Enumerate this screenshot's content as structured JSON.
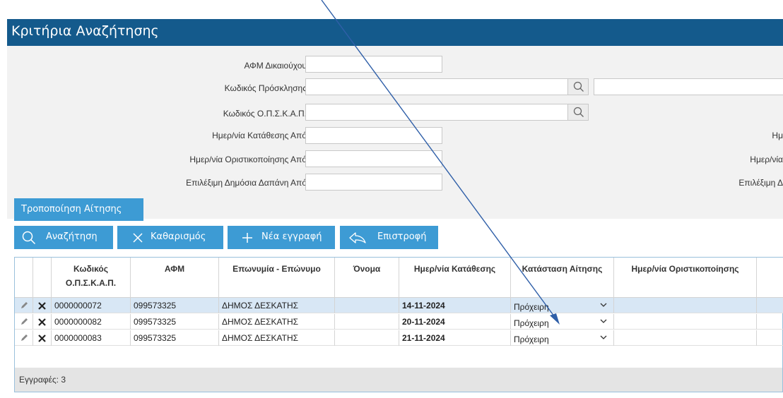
{
  "header": {
    "title": "Κριτήρια Αναζήτησης"
  },
  "fields": {
    "afm_label": "ΑΦΜ Δικαιούχου",
    "invitation_label": "Κωδικός Πρόσκλησης",
    "opskap_label": "Κωδικός Ο.Π.Σ.Κ.Α.Π.",
    "submit_from_label": "Ημερ/νία Κατάθεσης Από",
    "finalize_from_label": "Ημερ/νία Οριστικοποίησης Από",
    "expense_from_label": "Επιλέξιμη Δημόσια Δαπάνη Από",
    "submit_to_label_partial": "Ημ",
    "finalize_to_label_partial": "Ημερ/νία",
    "expense_to_label_partial": "Επιλέξιμη Δ"
  },
  "buttons": {
    "modify": "Τροποποίηση Αίτησης",
    "search": "Αναζήτηση",
    "clear": "Καθαρισμός",
    "new_record": "Νέα εγγραφή",
    "back": "Επιστροφή"
  },
  "colors": {
    "title_bar": "#145a8c",
    "button": "#3d9bd4",
    "selected_row": "#d8e7f5"
  },
  "table": {
    "columns": [
      "Κωδικός Ο.Π.Σ.Κ.Α.Π.",
      "ΑΦΜ",
      "Επωνυμία - Επώνυμο",
      "Όνομα",
      "Ημερ/νία Κατάθεσης",
      "Κατάσταση Αίτησης",
      "Ημερ/νία Οριστικοποίησης"
    ],
    "rows": [
      {
        "code": "0000000072",
        "afm": "099573325",
        "name": "ΔΗΜΟΣ ΔΕΣΚΑΤΗΣ",
        "first_name": "",
        "submit_date": "14-11-2024",
        "status": "Πρόχειρη",
        "finalize_date": ""
      },
      {
        "code": "0000000082",
        "afm": "099573325",
        "name": "ΔΗΜΟΣ ΔΕΣΚΑΤΗΣ",
        "first_name": "",
        "submit_date": "20-11-2024",
        "status": "Πρόχειρη",
        "finalize_date": ""
      },
      {
        "code": "0000000083",
        "afm": "099573325",
        "name": "ΔΗΜΟΣ ΔΕΣΚΑΤΗΣ",
        "first_name": "",
        "submit_date": "21-11-2024",
        "status": "Πρόχειρη",
        "finalize_date": ""
      }
    ],
    "footer": "Εγγραφές: 3"
  }
}
